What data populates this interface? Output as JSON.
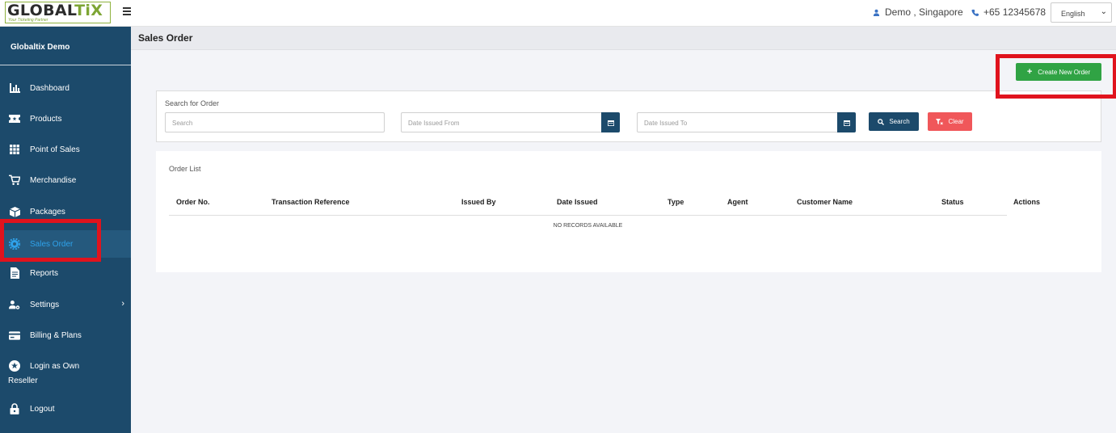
{
  "header": {
    "logo_main": "GLOBAL",
    "logo_accent": "TiX",
    "logo_tagline": "Your Ticketing Partner",
    "user": "Demo , Singapore",
    "phone": "+65 12345678",
    "language": "English"
  },
  "sidebar": {
    "account": "Globaltix Demo",
    "items": [
      {
        "label": "Dashboard",
        "icon": "bar-chart-icon"
      },
      {
        "label": "Products",
        "icon": "ticket-icon"
      },
      {
        "label": "Point of Sales",
        "icon": "grid-icon"
      },
      {
        "label": "Merchandise",
        "icon": "cart-icon"
      },
      {
        "label": "Packages",
        "icon": "box-icon"
      },
      {
        "label": "Sales Order",
        "icon": "cog-icon",
        "active": true
      },
      {
        "label": "Reports",
        "icon": "document-icon"
      },
      {
        "label": "Settings",
        "icon": "user-gear-icon"
      },
      {
        "label": "Billing & Plans",
        "icon": "card-icon"
      }
    ],
    "login_line1": "Login as Own",
    "login_line2": "Reseller",
    "logout": "Logout"
  },
  "page": {
    "title": "Sales Order",
    "create_button": "Create New Order"
  },
  "search": {
    "label": "Search for Order",
    "search_placeholder": "Search",
    "date_from_placeholder": "Date Issued From",
    "date_to_placeholder": "Date Issued To",
    "search_button": "Search",
    "clear_button": "Clear"
  },
  "orders": {
    "title": "Order List",
    "columns": [
      "Order No.",
      "Transaction Reference",
      "Issued By",
      "Date Issued",
      "Type",
      "Agent",
      "Customer Name",
      "Status",
      "Actions"
    ],
    "empty_text": "NO RECORDS AVAILABLE"
  },
  "colors": {
    "sidebar_bg": "#1c4a6b",
    "active_text": "#2fa2ea",
    "create_green": "#30a344",
    "clear_red": "#f0575a",
    "highlight_red": "#e0131d"
  }
}
